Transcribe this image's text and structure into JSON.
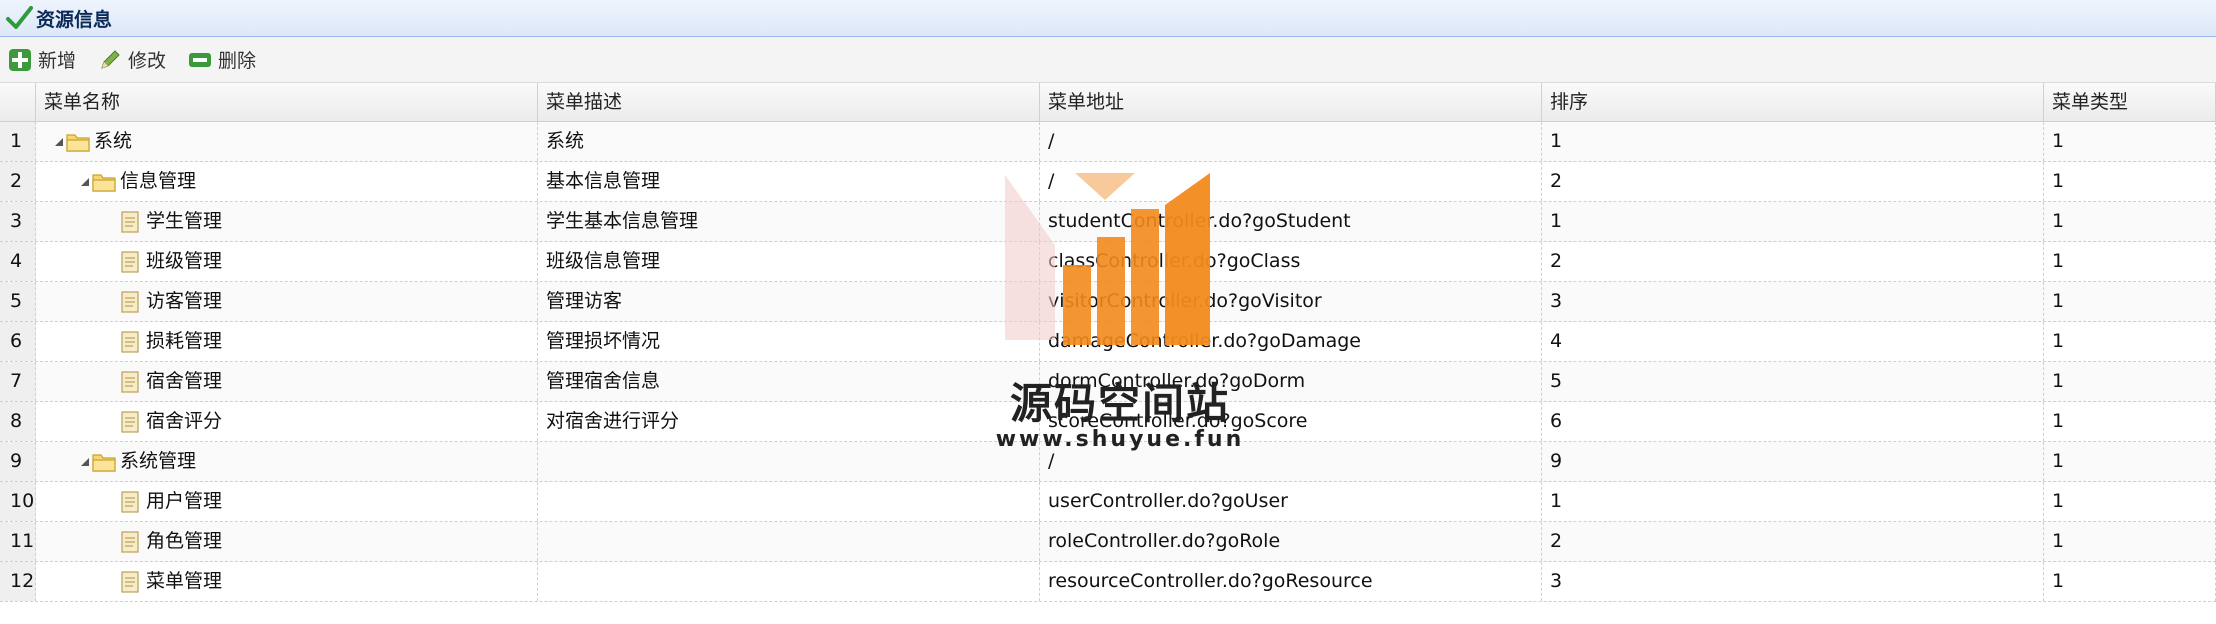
{
  "title": "资源信息",
  "toolbar": {
    "add": "新增",
    "edit": "修改",
    "delete": "删除"
  },
  "columns": [
    "菜单名称",
    "菜单描述",
    "菜单地址",
    "排序",
    "菜单类型"
  ],
  "rows": [
    {
      "num": "1",
      "level": 0,
      "expanded": true,
      "folder": true,
      "name": "系统",
      "desc": "系统",
      "url": "/",
      "sort": "1",
      "type": "1"
    },
    {
      "num": "2",
      "level": 1,
      "expanded": true,
      "folder": true,
      "name": "信息管理",
      "desc": "基本信息管理",
      "url": "/",
      "sort": "2",
      "type": "1"
    },
    {
      "num": "3",
      "level": 2,
      "folder": false,
      "name": "学生管理",
      "desc": "学生基本信息管理",
      "url": "studentController.do?goStudent",
      "sort": "1",
      "type": "1"
    },
    {
      "num": "4",
      "level": 2,
      "folder": false,
      "name": "班级管理",
      "desc": "班级信息管理",
      "url": "classController.do?goClass",
      "sort": "2",
      "type": "1"
    },
    {
      "num": "5",
      "level": 2,
      "folder": false,
      "name": "访客管理",
      "desc": "管理访客",
      "url": "visitorController.do?goVisitor",
      "sort": "3",
      "type": "1"
    },
    {
      "num": "6",
      "level": 2,
      "folder": false,
      "name": "损耗管理",
      "desc": "管理损坏情况",
      "url": "damageController.do?goDamage",
      "sort": "4",
      "type": "1"
    },
    {
      "num": "7",
      "level": 2,
      "folder": false,
      "name": "宿舍管理",
      "desc": "管理宿舍信息",
      "url": "dormController.do?goDorm",
      "sort": "5",
      "type": "1"
    },
    {
      "num": "8",
      "level": 2,
      "folder": false,
      "name": "宿舍评分",
      "desc": "对宿舍进行评分",
      "url": "scoreController.do?goScore",
      "sort": "6",
      "type": "1"
    },
    {
      "num": "9",
      "level": 1,
      "expanded": true,
      "folder": true,
      "name": "系统管理",
      "desc": "",
      "url": "/",
      "sort": "9",
      "type": "1"
    },
    {
      "num": "10",
      "level": 2,
      "folder": false,
      "name": "用户管理",
      "desc": "",
      "url": "userController.do?goUser",
      "sort": "1",
      "type": "1"
    },
    {
      "num": "11",
      "level": 2,
      "folder": false,
      "name": "角色管理",
      "desc": "",
      "url": "roleController.do?goRole",
      "sort": "2",
      "type": "1"
    },
    {
      "num": "12",
      "level": 2,
      "folder": false,
      "name": "菜单管理",
      "desc": "",
      "url": "resourceController.do?goResource",
      "sort": "3",
      "type": "1"
    }
  ],
  "watermark": {
    "title": "源码空间站",
    "url": "www.shuyue.fun"
  }
}
